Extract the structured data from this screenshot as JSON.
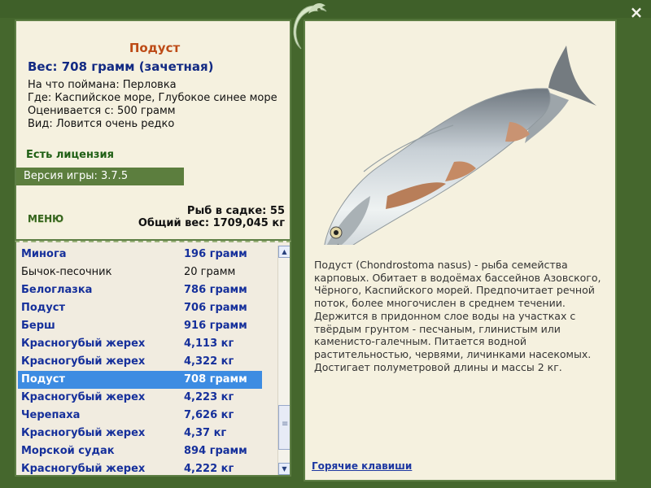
{
  "window": {
    "close_icon": "×"
  },
  "fish": {
    "name": "Подуст",
    "weight": "Вес: 708 грамм (зачетная)",
    "caught_on": "На что поймана: Перловка",
    "location": "Где: Каспийское море, Глубокое синее море",
    "rated_from": "Оценивается с: 500 грамм",
    "kind": "Вид: Ловится очень редко",
    "description": "Подуст (Chondrostoma nasus) - рыба семейства карповых. Обитает в водоёмах бассейнов Азовского, Чёрного, Каспийского морей. Предпочитает речной поток, более многочислен в среднем течении. Держится в придонном слое воды на участках с твёрдым грунтом - песчаным, глинистым или каменисто-галечным. Питается водной растительностью, червями, личинками насекомых. Достигает полуметровой длины и массы 2 кг."
  },
  "license": "Есть лицензия",
  "version": "Версия игры: 3.7.5",
  "menu": "МЕНЮ",
  "stats": {
    "in_net": "Рыб в садке: 55",
    "total": "Общий вес: 1709,045 кг"
  },
  "catch_list": [
    {
      "name": "Минога",
      "weight": "196 грамм",
      "style": "normal"
    },
    {
      "name": "Бычок-песочник",
      "weight": "20 грамм",
      "style": "plain"
    },
    {
      "name": "Белоглазка",
      "weight": "786 грамм",
      "style": "normal"
    },
    {
      "name": "Подуст",
      "weight": "706 грамм",
      "style": "normal"
    },
    {
      "name": "Берш",
      "weight": "916 грамм",
      "style": "normal"
    },
    {
      "name": "Красногубый жерех",
      "weight": "4,113 кг",
      "style": "normal"
    },
    {
      "name": "Красногубый жерех",
      "weight": "4,322 кг",
      "style": "normal"
    },
    {
      "name": "Подуст",
      "weight": "708 грамм",
      "style": "selected"
    },
    {
      "name": "Красногубый жерех",
      "weight": "4,223 кг",
      "style": "normal"
    },
    {
      "name": "Черепаха",
      "weight": "7,626 кг",
      "style": "normal"
    },
    {
      "name": "Красногубый жерех",
      "weight": "4,37 кг",
      "style": "normal"
    },
    {
      "name": "Морской судак",
      "weight": "894 грамм",
      "style": "normal"
    },
    {
      "name": "Красногубый жерех",
      "weight": "4,222 кг",
      "style": "normal"
    }
  ],
  "scrollbar": {
    "up_icon": "▲",
    "down_icon": "▼"
  },
  "hotkeys": "Горячие клавиши",
  "colors": {
    "frame": "#45672d",
    "panel": "#f5f1df",
    "accent": "#bd4b16",
    "selected": "#3d8ce2"
  }
}
